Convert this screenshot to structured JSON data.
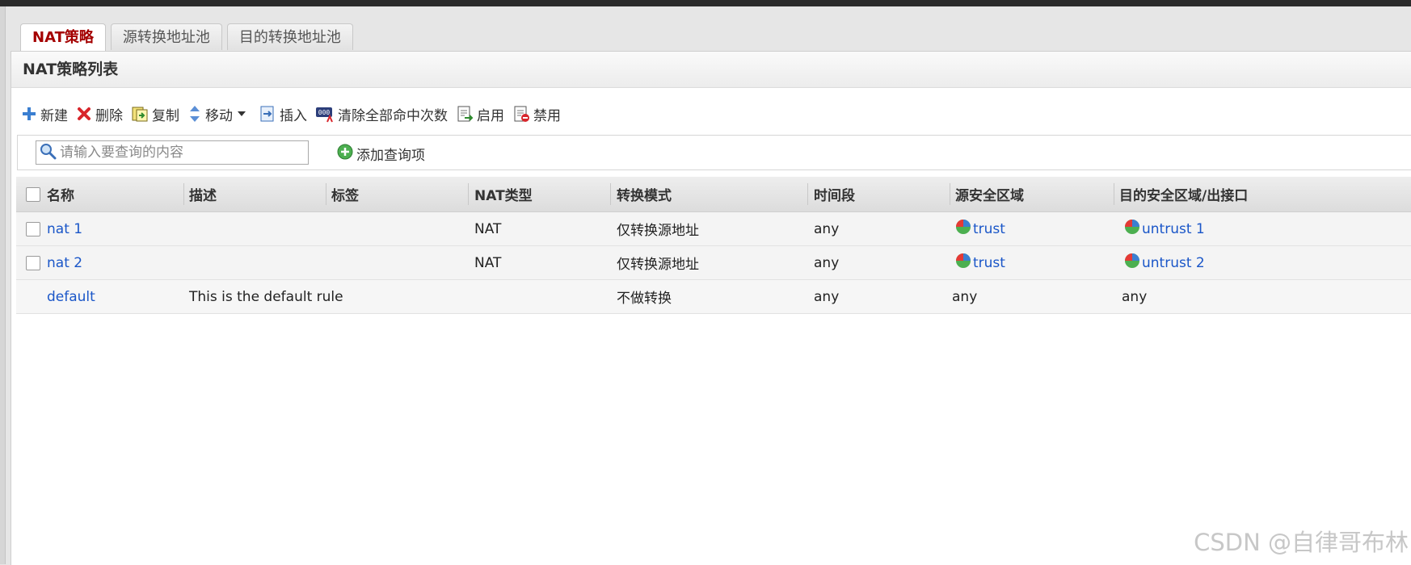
{
  "tabs": [
    {
      "label": "NAT策略",
      "active": true
    },
    {
      "label": "源转换地址池",
      "active": false
    },
    {
      "label": "目的转换地址池",
      "active": false
    }
  ],
  "panel": {
    "title": "NAT策略列表"
  },
  "toolbar": {
    "new_label": "新建",
    "delete_label": "删除",
    "copy_label": "复制",
    "move_label": "移动",
    "insert_label": "插入",
    "clear_hits_label": "清除全部命中次数",
    "enable_label": "启用",
    "disable_label": "禁用"
  },
  "search": {
    "placeholder": "请输入要查询的内容",
    "add_query_label": "添加查询项"
  },
  "table": {
    "columns": [
      "名称",
      "描述",
      "标签",
      "NAT类型",
      "转换模式",
      "时间段",
      "源安全区域",
      "目的安全区域/出接口"
    ],
    "rows": [
      {
        "name": "nat 1",
        "desc": "",
        "tag": "",
        "nat_type": "NAT",
        "mode": "仅转换源地址",
        "time": "any",
        "src_zone": "trust",
        "dst_zone": "untrust 1",
        "checkbox": true
      },
      {
        "name": "nat 2",
        "desc": "",
        "tag": "",
        "nat_type": "NAT",
        "mode": "仅转换源地址",
        "time": "any",
        "src_zone": "trust",
        "dst_zone": "untrust 2",
        "checkbox": true
      },
      {
        "name": "default",
        "desc": "This is the default rule",
        "tag": "",
        "nat_type": "",
        "mode": "不做转换",
        "time": "any",
        "src_zone": "any",
        "dst_zone": "any",
        "checkbox": false
      }
    ]
  },
  "watermark": "CSDN @自律哥布林",
  "colors": {
    "active_tab": "#a40000",
    "link": "#1a56c8"
  }
}
